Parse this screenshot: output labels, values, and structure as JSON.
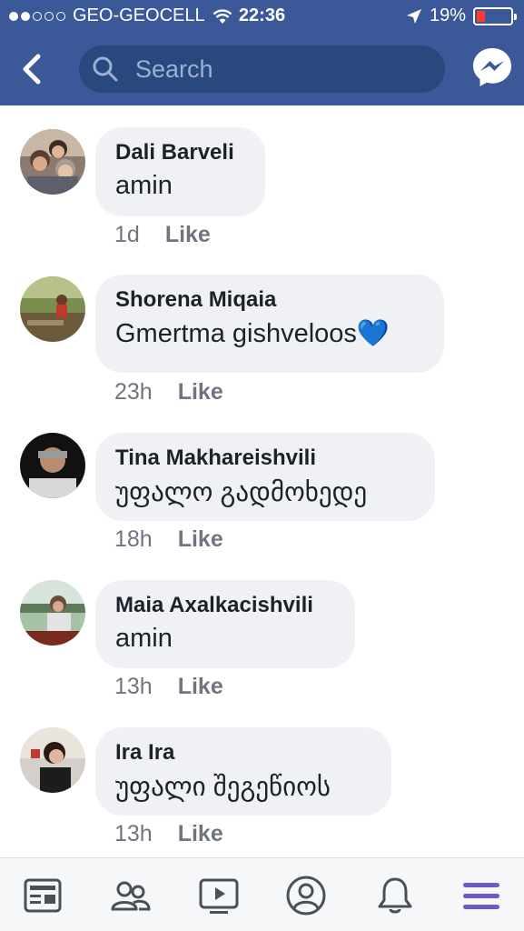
{
  "status_bar": {
    "carrier": "GEO-GEOCELL",
    "time": "22:36",
    "battery": "19%",
    "signal_icon": "signal-dots-icon",
    "wifi_icon": "wifi-icon",
    "location_icon": "location-arrow-icon"
  },
  "header": {
    "back_icon": "chevron-left-icon",
    "search_placeholder": "Search",
    "messenger_icon": "messenger-icon"
  },
  "colors": {
    "brand": "#3b5998",
    "search_bg": "#29487d",
    "bubble_bg": "#f0f1f4",
    "meta_text": "#6f7480",
    "battery_low": "#ff3b30",
    "nav_active": "#6b59c4"
  },
  "comments": [
    {
      "name": "Dali Barveli",
      "text": "amin",
      "time": "1d",
      "like": "Like"
    },
    {
      "name": "Shorena Miqaia",
      "text": "Gmertma gishveloos💙",
      "time": "23h",
      "like": "Like"
    },
    {
      "name": "Tina Makhareishvili",
      "text": "უფალო გადმოხედე",
      "time": "18h",
      "like": "Like"
    },
    {
      "name": "Maia Axalkacishvili",
      "text": "amin",
      "time": "13h",
      "like": "Like"
    },
    {
      "name": "Ira Ira",
      "text": "უფალი შეგეწიოს",
      "time": "13h",
      "like": "Like"
    }
  ],
  "bottom_nav": [
    {
      "icon": "news-feed-icon"
    },
    {
      "icon": "friends-icon"
    },
    {
      "icon": "watch-video-icon"
    },
    {
      "icon": "profile-icon"
    },
    {
      "icon": "notifications-bell-icon"
    },
    {
      "icon": "menu-icon"
    }
  ]
}
